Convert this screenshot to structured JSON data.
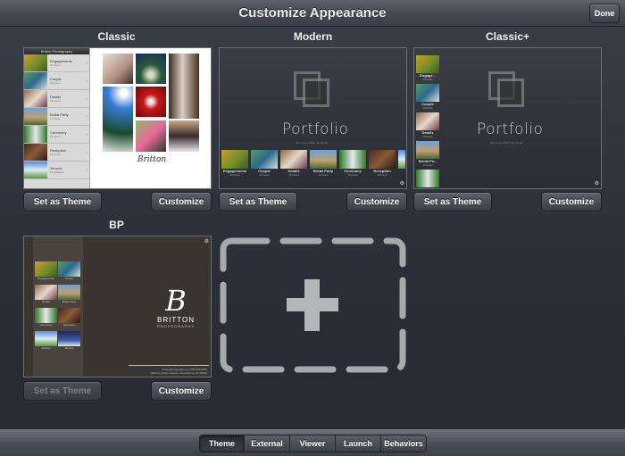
{
  "header": {
    "title": "Customize Appearance",
    "done_label": "Done"
  },
  "themes": [
    {
      "name": "Classic",
      "set_label": "Set as Theme",
      "customize_label": "Customize",
      "set_enabled": true,
      "preview": {
        "header": "Britton Photography",
        "galleries": [
          {
            "title": "Engagements",
            "count": "40 Items"
          },
          {
            "title": "Couple",
            "count": "40 Items"
          },
          {
            "title": "Details",
            "count": "15 Items"
          },
          {
            "title": "Bridal Party",
            "count": "14 Items"
          },
          {
            "title": "Ceremony",
            "count": "15 Items"
          },
          {
            "title": "Reception",
            "count": "16 Items"
          },
          {
            "title": "Venues",
            "count": "12 galleries"
          }
        ],
        "signature": "Britton"
      }
    },
    {
      "name": "Modern",
      "set_label": "Set as Theme",
      "customize_label": "Customize",
      "set_enabled": true,
      "preview": {
        "title": "Portfolio",
        "subtitle": "Tap to a portfolio the image",
        "galleries": [
          {
            "title": "Engagements",
            "count": "40 Items"
          },
          {
            "title": "Couple",
            "count": "40 Items"
          },
          {
            "title": "Details",
            "count": "15 Items"
          },
          {
            "title": "Bridal Party",
            "count": "14 Items"
          },
          {
            "title": "Ceremony",
            "count": "15 Items"
          },
          {
            "title": "Reception",
            "count": "16 Items"
          }
        ]
      }
    },
    {
      "name": "Classic+",
      "set_label": "Set as Theme",
      "customize_label": "Customize",
      "set_enabled": true,
      "preview": {
        "title": "Portfolio",
        "subtitle": "Tap to a portfolio the image",
        "galleries": [
          {
            "title": "Engage...",
            "count": "40 Items"
          },
          {
            "title": "Couple",
            "count": "40 Items"
          },
          {
            "title": "Details",
            "count": "15 Items"
          },
          {
            "title": "Bridal Pa...",
            "count": "14 Items"
          }
        ]
      }
    },
    {
      "name": "BP",
      "set_label": "Set as Theme",
      "customize_label": "Customize",
      "set_enabled": false,
      "preview": {
        "brand_initial": "B",
        "brand_name": "BRITTON",
        "brand_sub": "PHOTOGRAPHY",
        "galleries": [
          "Engagements",
          "Couple",
          "Details",
          "Bridal Party",
          "Ceremony",
          "Reception",
          "Venues",
          "Albums"
        ],
        "footer_line1": "brittonphotography.com 555.555.5555",
        "footer_line2": "1234 Anywhere Avenue, Somewhere, ST 00000"
      }
    }
  ],
  "add_theme": {
    "icon": "plus-icon"
  },
  "tabs": [
    {
      "label": "Theme",
      "active": true
    },
    {
      "label": "External",
      "active": false
    },
    {
      "label": "Viewer",
      "active": false
    },
    {
      "label": "Launch",
      "active": false
    },
    {
      "label": "Behaviors",
      "active": false
    }
  ],
  "colors": {
    "background": "#2e3139",
    "bar": "#4b4f57",
    "accent_line": "#9cc8d8"
  }
}
